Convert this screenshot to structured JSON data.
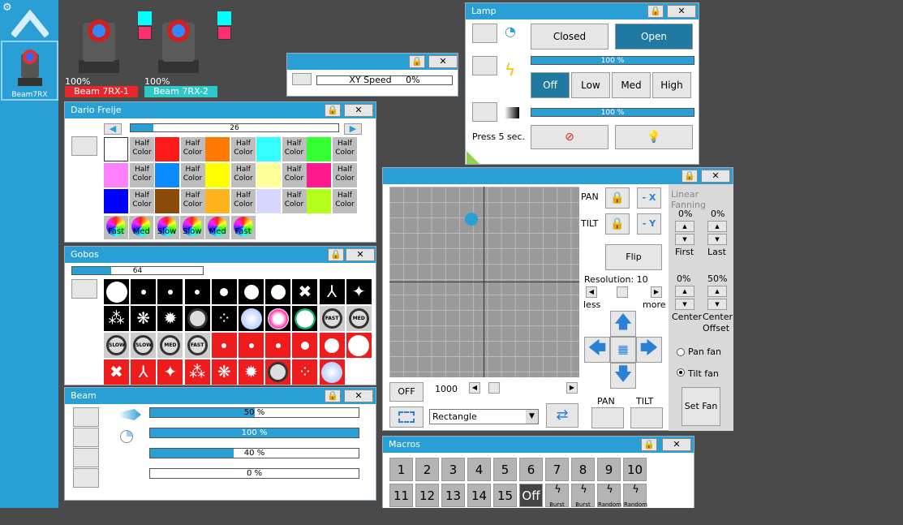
{
  "sidebar": {
    "selected_label": "Beam7RX",
    "settings_icon": "gear-icon",
    "up_icon": "chevron-up-icon"
  },
  "fixtures": [
    {
      "name": "Beam 7RX-1",
      "percent": "100%",
      "color": "#e8272d"
    },
    {
      "name": "Beam 7RX-2",
      "percent": "100%",
      "color": "#2fc8c8"
    }
  ],
  "xy_speed": {
    "label": "XY Speed",
    "value": "0%"
  },
  "lamp": {
    "title": "Lamp",
    "closed": "Closed",
    "open": "Open",
    "power_percent": "100 %",
    "power_value": 1.0,
    "levels": [
      "Off",
      "Low",
      "Med",
      "High"
    ],
    "dimmer_percent": "100 %",
    "dimmer_value": 1.0,
    "press_hint": "Press 5 sec."
  },
  "color": {
    "title": "Dario Freije",
    "slider_value": "26",
    "slider_fraction": 0.11,
    "half": "Half",
    "color_word": "Color",
    "swatches": [
      "#ffffff",
      "#ff1a1a",
      "#ff7a00",
      "#33ffff",
      "#33ff33",
      "#ff80ff",
      "#0a8cff",
      "#ffff00",
      "#ffff99",
      "#ff1a8c",
      "#0000ff",
      "#8b4a0a",
      "#ffb31a",
      "#d6d6ff",
      "#b3ff1a"
    ],
    "wheels": [
      "Fast",
      "Med",
      "Slow",
      "Slow",
      "Med",
      "Fast"
    ]
  },
  "gobos": {
    "title": "Gobos",
    "slider_value": "64",
    "slider_fraction": 0.3,
    "speed_labels": [
      "FAST",
      "MED",
      "SLOW",
      "SLOW",
      "MED",
      "FAST"
    ]
  },
  "beam": {
    "title": "Beam",
    "bars": [
      {
        "text": "50 %",
        "v": 0.5
      },
      {
        "text": "100 %",
        "v": 1.0
      },
      {
        "text": "40 %",
        "v": 0.4
      },
      {
        "text": "0 %",
        "v": 0.0
      }
    ]
  },
  "position": {
    "pan": "PAN",
    "tilt": "TILT",
    "neg_x": "- X",
    "neg_y": "- Y",
    "flip": "Flip",
    "resolution": "Resolution: 10",
    "less": "less",
    "more": "more",
    "off": "OFF",
    "speed_value": "1000",
    "shape": "Rectangle",
    "pan_label": "PAN",
    "tilt_label": "TILT",
    "cursor_x": 0.43,
    "cursor_y": 0.17
  },
  "fanning": {
    "title": "Linear Fanning",
    "first_pct": "0%",
    "last_pct": "0%",
    "first": "First",
    "last": "Last",
    "center_pct": "0%",
    "center_offset_pct": "50%",
    "center": "Center",
    "center_offset": "Center Offset",
    "pan_fan": "Pan fan",
    "tilt_fan": "Tilt fan",
    "set_fan": "Set Fan",
    "selected": "tilt"
  },
  "macros": {
    "title": "Macros",
    "row1": [
      "1",
      "2",
      "3",
      "4",
      "5",
      "6",
      "7",
      "8",
      "9",
      "10"
    ],
    "row2": [
      "11",
      "12",
      "13",
      "14",
      "15",
      "Off",
      "Burst",
      "Burst",
      "Random",
      "Random"
    ]
  }
}
